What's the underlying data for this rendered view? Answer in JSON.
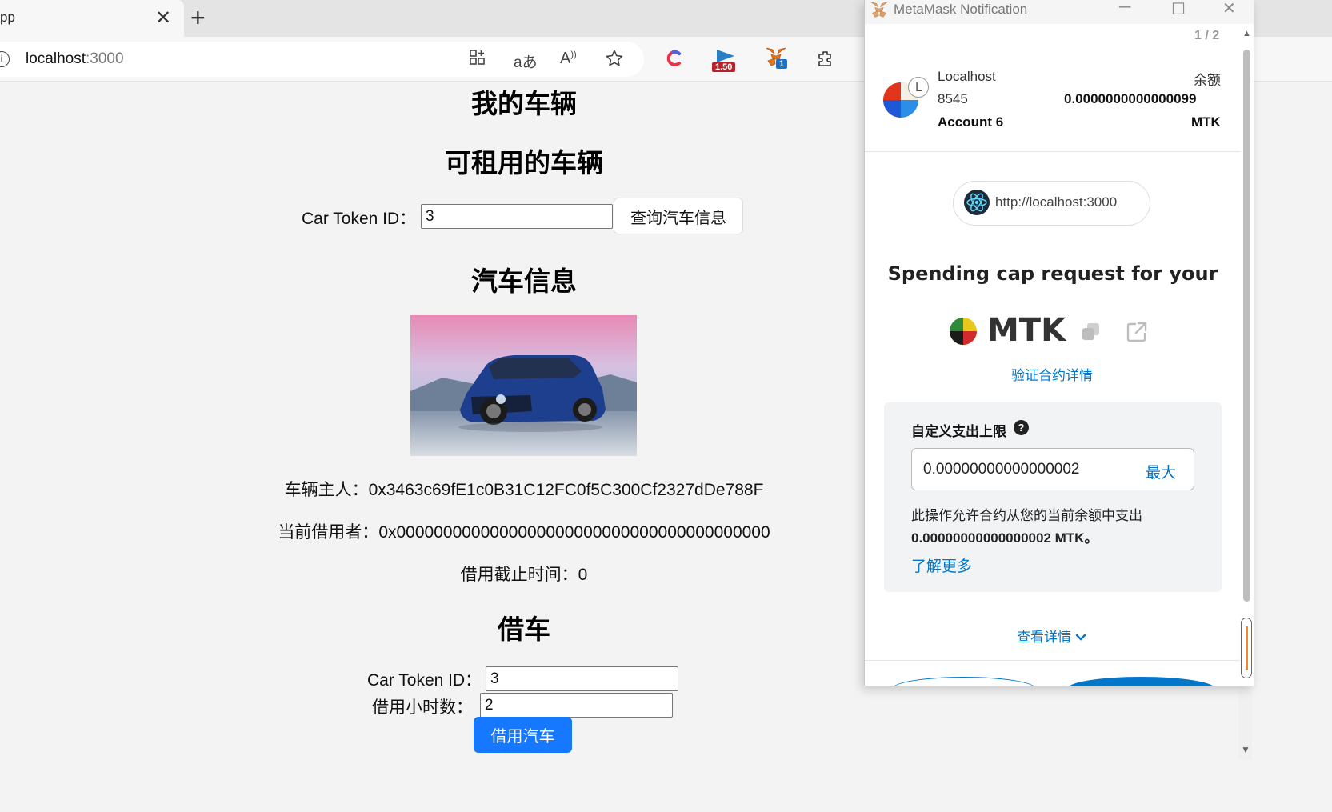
{
  "browser": {
    "tab_title": "pp",
    "tab_close": "✕",
    "new_tab": "+",
    "address_host": "localhost",
    "address_port": ":3000",
    "ext_badge_red": "1.50",
    "ext_badge_blue": "1"
  },
  "page": {
    "heading_my_cars": "我的车辆",
    "heading_available": "可租用的车辆",
    "query": {
      "label": "Car Token ID：",
      "value": "3",
      "button": "查询汽车信息"
    },
    "heading_car_info": "汽车信息",
    "car_image_alt": "car-photo",
    "owner_label": "车辆主人：",
    "owner_value": "0x3463c69fE1c0B31C12FC0f5C300Cf2327dDe788F",
    "borrower_label": "当前借用者：",
    "borrower_value": "0x0000000000000000000000000000000000000000",
    "expiry_label": "借用截止时间：",
    "expiry_value": "0",
    "heading_borrow": "借车",
    "borrow": {
      "token_label": "Car Token ID：",
      "token_value": "3",
      "hours_label": "借用小时数：",
      "hours_value": "2",
      "button": "借用汽车"
    }
  },
  "metamask": {
    "window_title": "MetaMask Notification",
    "pager": "1 / 2",
    "network_letter": "L",
    "network_name": "Localhost",
    "network_port": "8545",
    "account_name": "Account 6",
    "balance_label": "余额",
    "balance_value": "0.0000000000000099",
    "balance_unit": "MTK",
    "origin": "http://localhost:3000",
    "heading": "Spending cap request for your",
    "token_symbol": "MTK",
    "verify_link": "验证合约详情",
    "custom_label": "自定义支出上限",
    "help": "?",
    "cap_value": "0.00000000000000002",
    "max_label": "最大",
    "desc_line1": "此操作允许合约从您的当前余额中支出",
    "desc_line2": "0.00000000000000002 MTK。",
    "learn_more": "了解更多",
    "view_details": "查看详情",
    "colors": {
      "accent": "#0376c9",
      "primary_button": "#1677ff"
    }
  }
}
